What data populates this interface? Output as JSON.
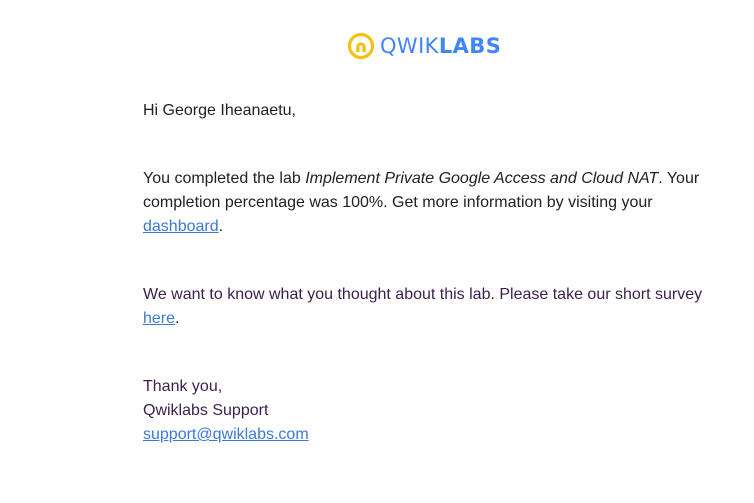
{
  "logo": {
    "text_light": "QWIK",
    "text_bold": "LABS",
    "mark_icon": "qwiklabs-logo-icon",
    "colors": {
      "ring": "#f4c20d",
      "text": "#4285f4"
    }
  },
  "greeting": "Hi George Iheanaetu,",
  "completion": {
    "prefix": "You completed the lab ",
    "lab_name": "Implement Private Google Access and Cloud NAT",
    "middle": ". Your completion percentage was 100%. Get more information by visiting your ",
    "link_text": "dashboard",
    "suffix": "."
  },
  "survey": {
    "prefix": "We want to know what you thought about this lab. Please take our short survey ",
    "link_text": "here",
    "suffix": "."
  },
  "signoff": {
    "thanks": "Thank you,",
    "team": "Qwiklabs Support",
    "email": "support@qwiklabs.com"
  },
  "colors": {
    "link": "#3c78d8",
    "body_text": "#202124",
    "purple_text": "#3b1f4c"
  }
}
